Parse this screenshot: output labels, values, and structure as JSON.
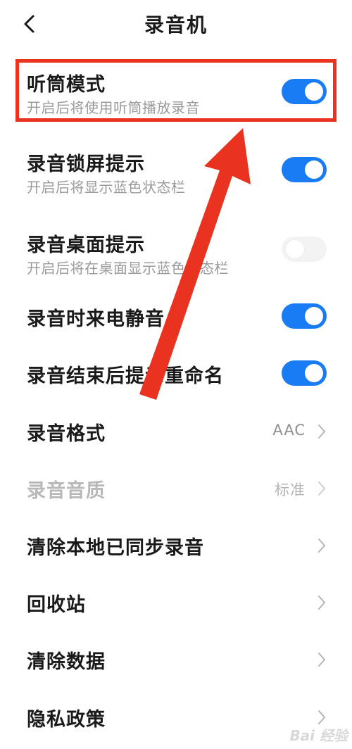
{
  "header": {
    "title": "录音机",
    "back_icon": "chevron-left-icon"
  },
  "colors": {
    "accent": "#1a7cf5",
    "annotation_red": "#e9321f"
  },
  "settings": [
    {
      "label": "听筒模式",
      "sub": "开启后将使用听筒播放录音",
      "toggle": true
    },
    {
      "label": "录音锁屏提示",
      "sub": "开启后将显示蓝色状态栏",
      "toggle": true
    },
    {
      "label": "录音桌面提示",
      "sub": "开启后将在桌面显示蓝色状态栏",
      "toggle": false
    },
    {
      "label": "录音时来电静音",
      "toggle": true
    },
    {
      "label": "录音结束后提示重命名",
      "toggle": true
    },
    {
      "label": "录音格式",
      "value": "AAC"
    },
    {
      "label": "录音音质",
      "value": "标准"
    },
    {
      "label": "清除本地已同步录音"
    },
    {
      "label": "回收站"
    },
    {
      "label": "清除数据"
    },
    {
      "label": "隐私政策"
    }
  ],
  "watermark": "Bai 经验"
}
